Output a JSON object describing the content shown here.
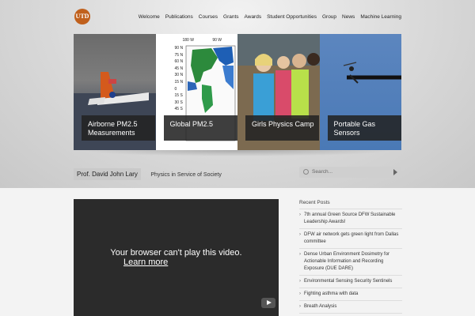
{
  "logo": {
    "text": "UTD",
    "color": "#c0601c"
  },
  "nav": [
    "Welcome",
    "Publications",
    "Courses",
    "Grants",
    "Awards",
    "Student Opportunities",
    "Group",
    "News",
    "Machine Learning"
  ],
  "slides": [
    {
      "caption": "Airborne PM2.5 Measurements"
    },
    {
      "caption": "Global PM2.5",
      "lat_labels": [
        "90 N",
        "75 N",
        "60 N",
        "45 N",
        "30 N",
        "15 N",
        "0",
        "15 S",
        "30 S",
        "45 S"
      ],
      "lon_labels": [
        "180 W",
        "90 W"
      ]
    },
    {
      "caption": "Girls Physics Camp"
    },
    {
      "caption": "Portable Gas Sensors"
    }
  ],
  "subbar": {
    "name": "Prof. David John Lary",
    "tagline": "Physics in Service of Society"
  },
  "search": {
    "placeholder": "Search..."
  },
  "video": {
    "message": "Your browser can't play this video.",
    "link": "Learn more"
  },
  "recent_posts": {
    "title": "Recent Posts",
    "items": [
      "7th annual Green Source DFW Sustainable Leadership Awards!",
      "DFW air network gets green light from Dallas committee",
      "Dense Urban Environment Dosimetry for Actionable Information and Recording Exposure (DUE DARE)",
      "Environmental Sensing Security Sentinels",
      "Fighting asthma with data",
      "Breath Analysis"
    ]
  }
}
